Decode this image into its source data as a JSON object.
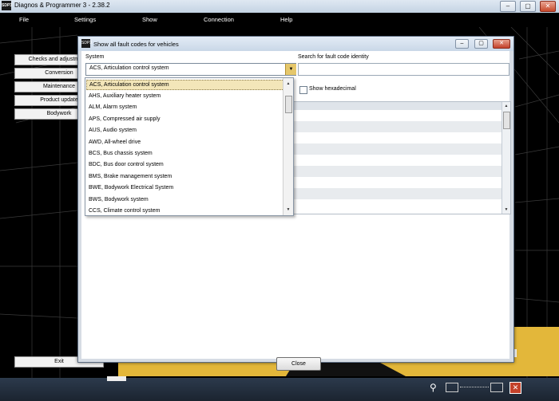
{
  "app": {
    "title": "Diagnos & Programmer 3  -  2.38.2",
    "icon_text": "SDP3"
  },
  "menu": [
    "File",
    "Settings",
    "Show",
    "Connection",
    "Help"
  ],
  "left_buttons": [
    "Checks and adjustments",
    "Conversion",
    "Maintenance",
    "Product update",
    "Bodywork"
  ],
  "exit_label": "Exit",
  "dialog": {
    "title": "Show all fault codes for vehicles",
    "system_label": "System",
    "system_value": "ACS, Articulation control system",
    "search_label": "Search for fault code identity",
    "search_value": "",
    "hex_label": "Show hexadecimal",
    "close_label": "Close",
    "dropdown_items": [
      "ACS, Articulation control system",
      "AHS, Auxiliary heater system",
      "ALM, Alarm system",
      "APS, Compressed air supply",
      "AUS, Audio system",
      "AWD, All-wheel drive",
      "BCS, Bus chassis system",
      "BDC, Bus door control system",
      "BMS, Brake management system",
      "BWE, Bodywork Electrical System",
      "BWS, Bodywork system",
      "CCS, Climate control system"
    ],
    "selected_index": 0
  },
  "colors": {
    "accent_yellow": "#e3b73a",
    "selection": "#f3e6b9",
    "close_red": "#c3412a"
  }
}
